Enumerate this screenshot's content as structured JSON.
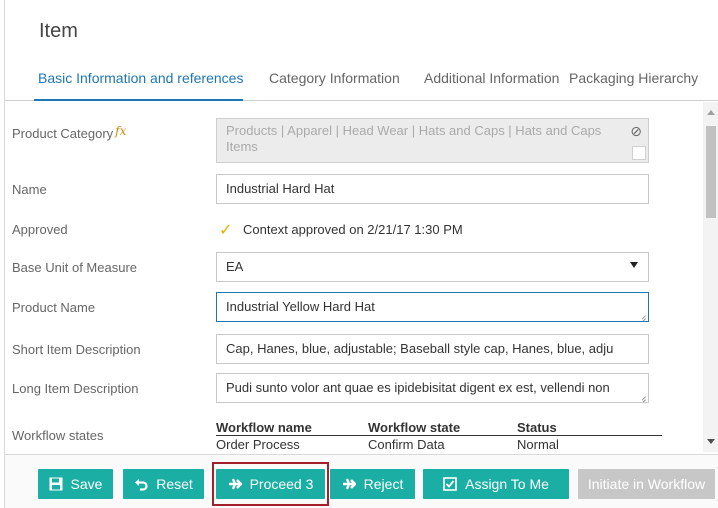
{
  "page": {
    "title": "Item"
  },
  "tabs": [
    {
      "label": "Basic Information and references",
      "active": true
    },
    {
      "label": "Category Information",
      "active": false
    },
    {
      "label": "Additional Information",
      "active": false
    },
    {
      "label": "Packaging Hierarchy",
      "active": false
    }
  ],
  "form": {
    "product_category": {
      "label": "Product Category",
      "fx": "fx",
      "value": "Products | Apparel | Head Wear | Hats and Caps | Hats and Caps Items",
      "clear_glyph": "⊘"
    },
    "name": {
      "label": "Name",
      "value": "Industrial Hard Hat"
    },
    "approved": {
      "label": "Approved",
      "check_glyph": "✓",
      "text": "Context approved on 2/21/17 1:30 PM"
    },
    "base_unit": {
      "label": "Base Unit of Measure",
      "value": "EA"
    },
    "product_name": {
      "label": "Product Name",
      "value": "Industrial Yellow Hard Hat"
    },
    "short_desc": {
      "label": "Short Item Description",
      "value": "Cap, Hanes, blue, adjustable; Baseball style cap, Hanes, blue, adju"
    },
    "long_desc": {
      "label": "Long Item Description",
      "value": "Pudi sunto volor ant quae es ipidebisitat digent ex est, vellendi non"
    },
    "workflow": {
      "label": "Workflow states",
      "headers": [
        "Workflow name",
        "Workflow state",
        "Status"
      ],
      "rows": [
        [
          "Order Process",
          "Confirm Data",
          "Normal"
        ]
      ]
    }
  },
  "toolbar": {
    "save": {
      "label": "Save",
      "icon": "save-icon"
    },
    "reset": {
      "label": "Reset",
      "icon": "undo-icon"
    },
    "proceed": {
      "label": "Proceed 3",
      "icon": "plane-icon"
    },
    "reject": {
      "label": "Reject",
      "icon": "plane-icon"
    },
    "assign": {
      "label": "Assign To Me",
      "icon": "checkbox-icon"
    },
    "initiate": {
      "label": "Initiate in Workflow"
    }
  },
  "colors": {
    "accent": "#1f77b4",
    "button": "#1aaea5",
    "disabled_button": "#c7c7c7",
    "highlight": "#a31f2c",
    "approved_check": "#f0b000"
  }
}
